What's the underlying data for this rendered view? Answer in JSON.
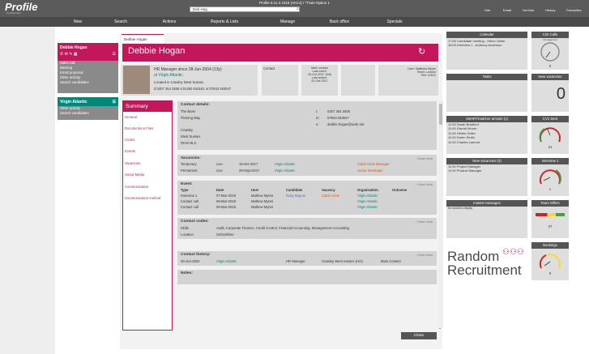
{
  "app": {
    "name": "Profile",
    "tagline": "by eRecruiter",
    "window_title": "Profile 8.11.3.1016 (AH14) / *Train-Option 1",
    "search_value": "Deb Hog"
  },
  "quick_links": [
    "Hub",
    "Email",
    "Hot lists",
    "History",
    "Favourites"
  ],
  "nav": [
    "New",
    "Search",
    "Actions",
    "Reports & Lists",
    "Manage",
    "Back office",
    "Specials"
  ],
  "sidebar": {
    "contact_card": {
      "name": "Debbie Hogan",
      "links": [
        "Sales call",
        "Meeting",
        "Email proposal",
        "Other activity",
        "Search candidates"
      ]
    },
    "company_card": {
      "name": "Virgin Atlantic",
      "links": [
        "Other activity",
        "Search candidates"
      ]
    }
  },
  "record": {
    "tab": "Debbie Hogan",
    "name": "Debbie Hogan",
    "title_line": "HR Manager since 28-Jun-2004 (13y)",
    "company_line": "at Virgin Atlantic",
    "location_line": "Located in Crawley West Sussex",
    "phone_line": "d:0207 354 2636 s:01293 616161 m:07843 263547",
    "contact_label": "Contact",
    "main_contact": [
      "Main contact",
      "Last event:",
      "20-Oct-2017 (Intl)",
      "Last action:",
      "20-Oct-2017"
    ],
    "user_info": [
      "User: Matthew Myres",
      "Team: London",
      "Ref: 10012"
    ]
  },
  "summary": {
    "title": "Summary",
    "items": [
      "General",
      "Documents & Files",
      "Codes",
      "Events",
      "Vacancies",
      "Social Media",
      "Communication",
      "Communication method"
    ]
  },
  "contact_details": {
    "title": "Contact details:",
    "address": [
      "The Base",
      "Fleming Way",
      "",
      "Crawley",
      "West Sussex",
      "RH10 9LX"
    ],
    "phones": [
      {
        "k": "t:",
        "v": "0207 354 2636"
      },
      {
        "k": "m:",
        "v": "07843 263547"
      },
      {
        "k": "e:",
        "v": "debbie.hogan@work.net"
      }
    ]
  },
  "vacancies": {
    "title": "Vacancies:",
    "show_more": "...Show more",
    "rows": [
      [
        "Temporary",
        "Live",
        "19-Oct-2017",
        "Virgin Atlantic",
        "Cabin Crew Manager"
      ],
      [
        "Permanent",
        "Live",
        "29-Sept-2017",
        "Virgin Atlantic",
        "Junior Developer"
      ]
    ]
  },
  "events": {
    "title": "Event:",
    "show_more": "...Show more",
    "headers": [
      "Type",
      "Date",
      "User",
      "Candidate",
      "Vacancy",
      "Organisation",
      "Outcome"
    ],
    "rows": [
      [
        "Interview 1",
        "07-Mar-2018",
        "Mathew Myres",
        "Ruby Begum",
        "Cabin Crew",
        "Virgin Atlantic",
        ""
      ],
      [
        "Contact call",
        "06-Mar-2018",
        "Mathew Myres",
        "",
        "",
        "Virgin Atlantic",
        ""
      ],
      [
        "Contact call",
        "06-Mar-2018",
        "Mathew Myres",
        "",
        "",
        "Virgin Atlantic",
        ""
      ]
    ]
  },
  "codes": {
    "title": "Contact codes:",
    "show_more": "...Show more",
    "rows": [
      [
        "Skills",
        "Audit, Corporate Finance, Credit Control, Financial Accounting, Management Accounting"
      ],
      [
        "Location",
        "Oxfordshire"
      ]
    ]
  },
  "history": {
    "title": "Contact history:",
    "show_more": "...Show more",
    "row": [
      "28-Jun-2004",
      "Virgin Atlantic",
      "HR Manager",
      "Crawley West Sussex (HO)",
      "Main Contact"
    ]
  },
  "notes": {
    "title": "Notes:"
  },
  "close_label": "Close",
  "widgets": {
    "calendar": {
      "title": "Calendar",
      "rows": [
        "17:00  Candidate meeting - Helen Geller",
        "16:00  Interview 1 - Anthony Anderson"
      ]
    },
    "cint_calls": {
      "title": "Cint Calls",
      "value": "0",
      "note": "No target set"
    },
    "tasks": {
      "title": "Tasks"
    },
    "new_vacancies": {
      "title": "New vacancies",
      "value": "0"
    },
    "smartmatcher": {
      "title": "SMARTmatcher arrivals (1)",
      "rows": [
        "11:00  Sarah Bradford",
        "11:00  Gareth Moore",
        "11:00  Hellen Geller",
        "11:00  Karen Smith",
        "11:00  Charles Lamont"
      ]
    },
    "cvs_sent": {
      "title": "CVs Sent",
      "value": "21",
      "min": "0",
      "max": "50"
    },
    "new_vac_list": {
      "title": "New vacancies (2)",
      "rows": [
        "11:00  Project Manager",
        "11:00  Product Manager"
      ]
    },
    "interview1": {
      "title": "Interview 1",
      "value": "1"
    },
    "instant_messages": {
      "title": "Instant messages",
      "note": "No records to display"
    },
    "team_offers": {
      "title": "Team Offers",
      "value": "37"
    },
    "bookings": {
      "title": "Bookings",
      "value": "0"
    }
  },
  "brand": {
    "line1": "Random",
    "line2": "Recruitment"
  },
  "colors": {
    "accent": "#c2185b",
    "teal": "#00897b",
    "orange": "#e65100"
  }
}
